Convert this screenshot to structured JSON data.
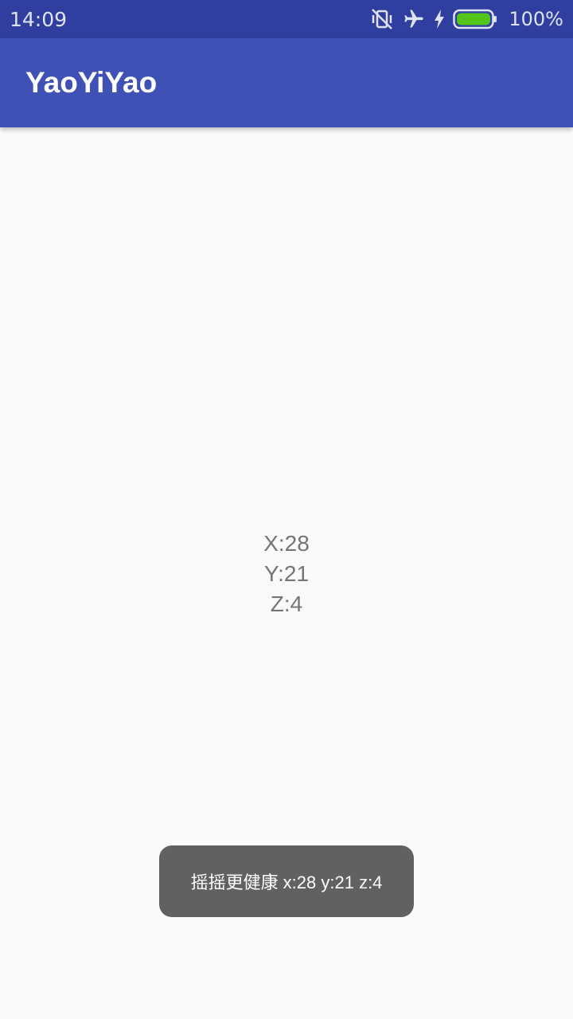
{
  "status_bar": {
    "time": "14:09",
    "battery_percent": "100%",
    "icons": [
      "vibrate-icon",
      "airplane-mode-icon",
      "charging-bolt-icon",
      "battery-icon"
    ],
    "battery_level": 1.0,
    "battery_color": "#52c41a"
  },
  "app_bar": {
    "title": "YaoYiYao",
    "color": "#3f51b5"
  },
  "readings": {
    "x": "X:28",
    "y": "Y:21",
    "z": "Z:4"
  },
  "toast": {
    "message": "摇摇更健康 x:28 y:21 z:4"
  }
}
